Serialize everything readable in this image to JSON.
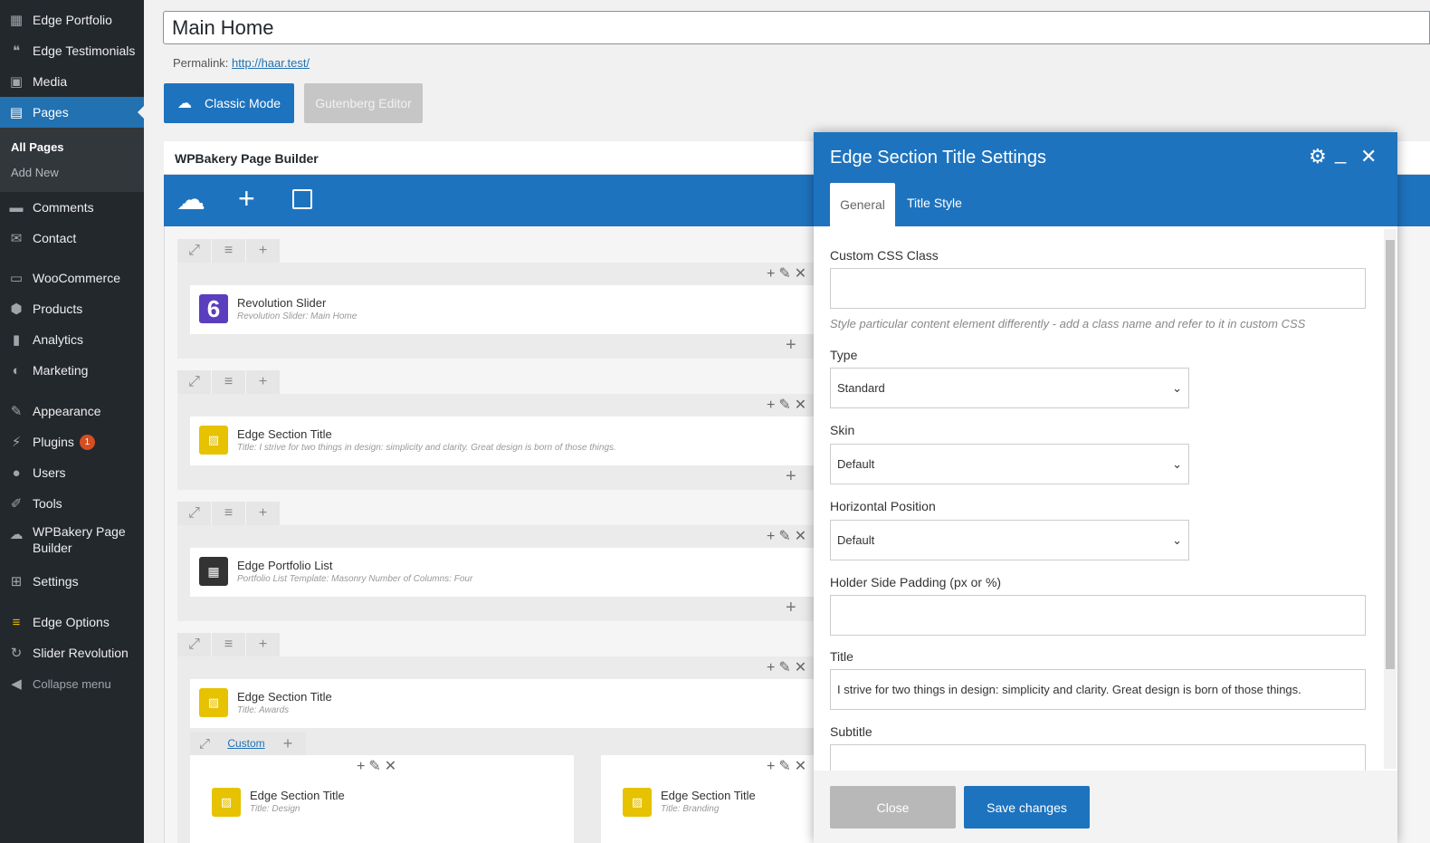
{
  "sidebar": {
    "items": [
      {
        "label": "Edge Portfolio",
        "icon": "grid-icon"
      },
      {
        "label": "Edge Testimonials",
        "icon": "quote-icon"
      },
      {
        "label": "Media",
        "icon": "media-icon"
      },
      {
        "label": "Pages",
        "icon": "pages-icon"
      },
      {
        "label": "Comments",
        "icon": "comment-icon"
      },
      {
        "label": "Contact",
        "icon": "mail-icon"
      },
      {
        "label": "WooCommerce",
        "icon": "woo-icon"
      },
      {
        "label": "Products",
        "icon": "box-icon"
      },
      {
        "label": "Analytics",
        "icon": "chart-icon"
      },
      {
        "label": "Marketing",
        "icon": "megaphone-icon"
      },
      {
        "label": "Appearance",
        "icon": "brush-icon"
      },
      {
        "label": "Plugins",
        "icon": "plug-icon",
        "badge": "1"
      },
      {
        "label": "Users",
        "icon": "user-icon"
      },
      {
        "label": "Tools",
        "icon": "wrench-icon"
      },
      {
        "label": "WPBakery Page",
        "label2": "Builder",
        "icon": "cloud-icon"
      },
      {
        "label": "Settings",
        "icon": "settings-icon"
      },
      {
        "label": "Edge Options",
        "icon": "edge-icon"
      },
      {
        "label": "Slider Revolution",
        "icon": "refresh-icon"
      },
      {
        "label": "Collapse menu",
        "icon": "collapse-icon"
      }
    ],
    "submenu": [
      "All Pages",
      "Add New"
    ]
  },
  "editor": {
    "title": "Main Home",
    "permalink_label": "Permalink:",
    "permalink_url": "http://haar.test/",
    "classic_mode": "Classic Mode",
    "gutenberg": "Gutenberg Editor"
  },
  "wpbakery": {
    "title": "WPBakery Page Builder",
    "custom_label": "Custom",
    "elements": [
      {
        "title": "Revolution Slider",
        "sub": "Revolution Slider: Main Home"
      },
      {
        "title": "Edge Section Title",
        "sub": "Title: I strive for two things in design: simplicity and clarity. Great design is born of those things."
      },
      {
        "title": "Edge Portfolio List",
        "sub": "Portfolio List Template: Masonry  Number of Columns: Four"
      },
      {
        "title": "Edge Section Title",
        "sub": "Title: Awards"
      },
      {
        "title": "Edge Section Title",
        "sub": "Title: Design"
      },
      {
        "title": "Edge Section Title",
        "sub": "Title: Branding"
      }
    ]
  },
  "modal": {
    "title": "Edge Section Title Settings",
    "tabs": [
      "General",
      "Title Style"
    ],
    "fields": {
      "css_label": "Custom CSS Class",
      "css_value": "",
      "css_hint": "Style particular content element differently - add a class name and refer to it in custom CSS",
      "type_label": "Type",
      "type_value": "Standard",
      "skin_label": "Skin",
      "skin_value": "Default",
      "hpos_label": "Horizontal Position",
      "hpos_value": "Default",
      "padding_label": "Holder Side Padding (px or %)",
      "padding_value": "",
      "title_label": "Title",
      "title_value": "I strive for two things in design: simplicity and clarity. Great design is born of those things.",
      "subtitle_label": "Subtitle",
      "subtitle_value": ""
    },
    "close": "Close",
    "save": "Save changes"
  },
  "colors": {
    "accent": "#1e73be",
    "sidebar": "#23282d"
  }
}
